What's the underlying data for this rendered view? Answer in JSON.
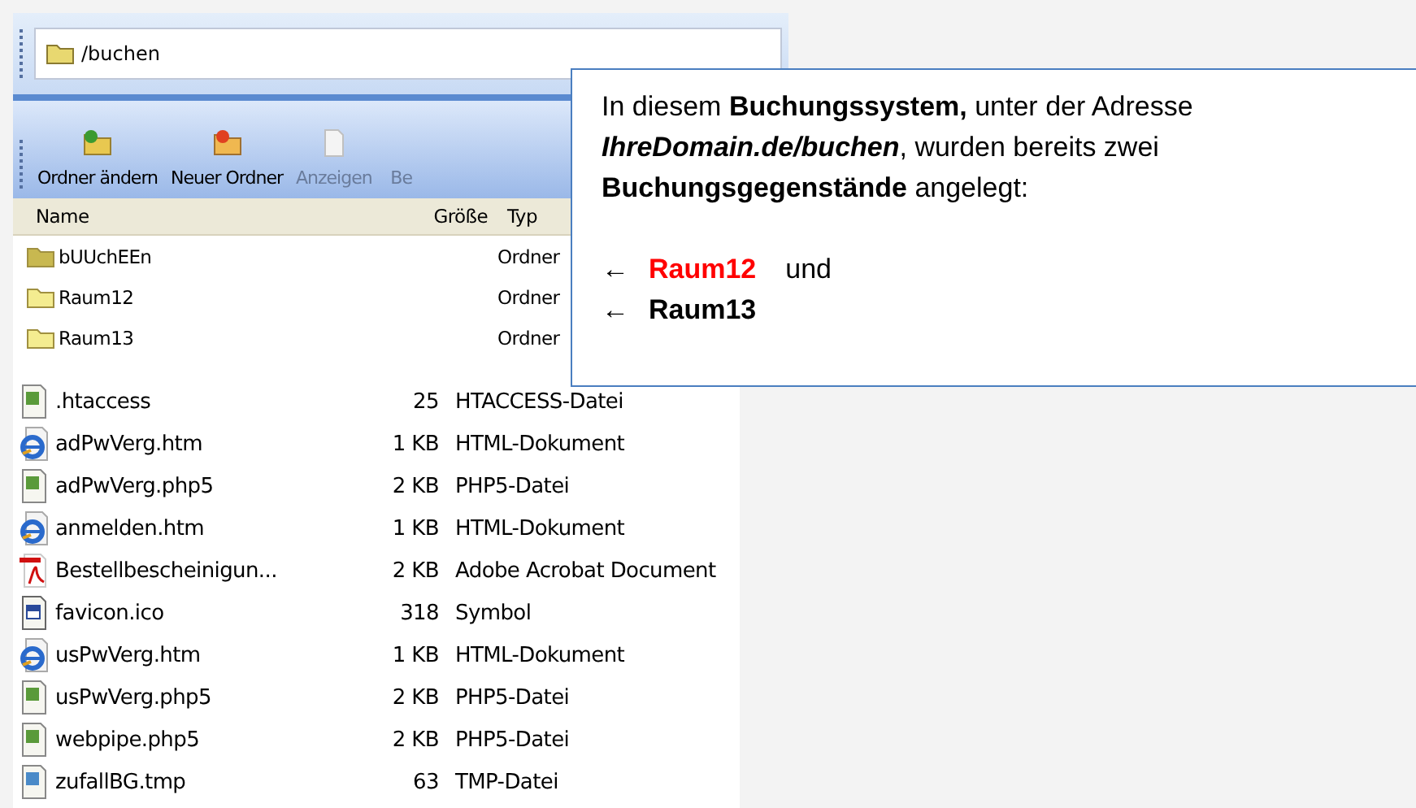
{
  "address_bar": {
    "path": "/buchen"
  },
  "toolbar": [
    {
      "label": "Ordner ändern",
      "kind": "folderedit",
      "disabled": false
    },
    {
      "label": "Neuer Ordner",
      "kind": "foldernew",
      "disabled": false
    },
    {
      "label": "Anzeigen",
      "kind": "view",
      "disabled": true
    },
    {
      "label": "Be",
      "kind": "other",
      "disabled": true
    }
  ],
  "columns": [
    "Name",
    "Größe",
    "Typ"
  ],
  "folders": [
    {
      "name": "bUUchEEn",
      "type": "Ordner",
      "selected": false
    },
    {
      "name": "Raum12",
      "type": "Ordner",
      "selected": false
    },
    {
      "name": "Raum13",
      "type": "Ordner",
      "selected": false
    }
  ],
  "files": [
    {
      "name": ".htaccess",
      "size": "25",
      "type": "HTACCESS-Datei",
      "kind": "script"
    },
    {
      "name": "adPwVerg.htm",
      "size": "1 KB",
      "type": "HTML-Dokument",
      "kind": "web"
    },
    {
      "name": "adPwVerg.php5",
      "size": "2 KB",
      "type": "PHP5-Datei",
      "kind": "script"
    },
    {
      "name": "anmelden.htm",
      "size": "1 KB",
      "type": "HTML-Dokument",
      "kind": "web"
    },
    {
      "name": "Bestellbescheinigun...",
      "size": "2 KB",
      "type": "Adobe Acrobat Document",
      "kind": "pdf"
    },
    {
      "name": "favicon.ico",
      "size": "318",
      "type": "Symbol",
      "kind": "image"
    },
    {
      "name": "usPwVerg.htm",
      "size": "1 KB",
      "type": "HTML-Dokument",
      "kind": "web"
    },
    {
      "name": "usPwVerg.php5",
      "size": "2 KB",
      "type": "PHP5-Datei",
      "kind": "script"
    },
    {
      "name": "webpipe.php5",
      "size": "2 KB",
      "type": "PHP5-Datei",
      "kind": "script"
    },
    {
      "name": "zufallBG.tmp",
      "size": "63",
      "type": "TMP-Datei",
      "kind": "temp"
    }
  ],
  "callout": {
    "text": "In diesem **Buchungssystem,** unter der Adresse *IhreDomain.de/buchen*, wurden bereits zwei **Buchungsgegenstände** angelegt:",
    "items": [
      {
        "arrow": "←",
        "name": "Raum12",
        "color": "#ff0000",
        "suffix": "und"
      },
      {
        "arrow": "←",
        "name": "Raum13",
        "color": "#000000"
      }
    ]
  }
}
